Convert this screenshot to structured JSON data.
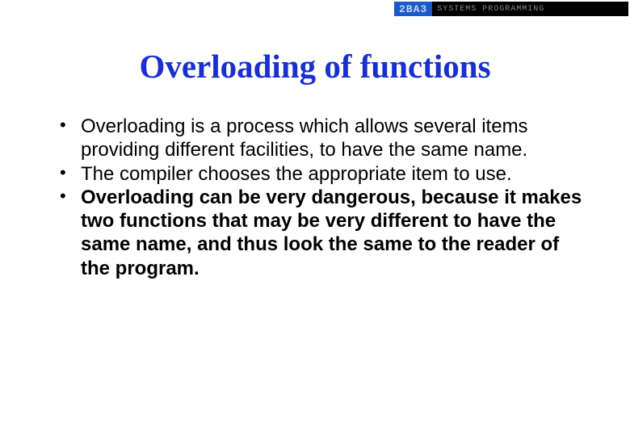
{
  "header": {
    "code": "2BA3",
    "label": "SYSTEMS PROGRAMMING"
  },
  "slide": {
    "title": "Overloading of functions",
    "bullets": [
      {
        "text": "Overloading is a process which allows several items providing different facilities, to have the same name.",
        "bold": false
      },
      {
        "text": "The compiler chooses the appropriate item to use.",
        "bold": false
      },
      {
        "text": "Overloading can be very dangerous, because it makes two functions that may be very different to have the same name, and thus look the same to the reader of the program.",
        "bold": true
      }
    ]
  }
}
